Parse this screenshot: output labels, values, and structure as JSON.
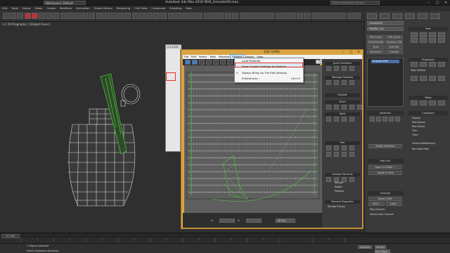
{
  "titlebar": {
    "workspace": "Workspace: Default",
    "title": "Autodesk 3ds Max 2016     MAX_Grenade00.max",
    "search_placeholder": "Type a keyword or phrase"
  },
  "main_menu": [
    "Edit",
    "Tools",
    "Group",
    "Views",
    "Create",
    "Modifiers",
    "Animation",
    "Graph Editors",
    "Rendering",
    "Civil View",
    "Customize",
    "Scripting",
    "Help"
  ],
  "viewport": {
    "label": "[+] [Orthographic ] [Edged Faces]"
  },
  "modifier_float": {
    "title": "v.4.1016"
  },
  "uvw_window": {
    "title": "Edit UVWs",
    "menu": [
      "File",
      "Edit",
      "Select",
      "Tools",
      "Mapping",
      "Options",
      "Display",
      "View"
    ],
    "active_menu": "Options",
    "map_dropdown": "CheckerPattern ( Checker )",
    "options_menu": [
      {
        "label": "Load Defaults",
        "shortcut": "",
        "checked": false
      },
      {
        "label": "Save Current Settings As Default",
        "shortcut": "",
        "checked": false
      },
      {
        "label": "Always Bring Up The Edit Window",
        "shortcut": "",
        "checked": true
      },
      {
        "label": "Preferences...",
        "shortcut": "Ctrl+O",
        "checked": false
      }
    ],
    "right_panel": {
      "quick_transform": "Quick Transform",
      "reshape": "Reshape Elements",
      "stitch": "Stitch",
      "explode": "Explode",
      "weld": "Weld",
      "peel": "Peel",
      "arrange": "Arrange Elements",
      "rescale": "Rescale",
      "rotate": "Rotate",
      "padding": "Padding:",
      "element_props": "Element Properties",
      "rescale_priority": "Rescale Priority"
    },
    "bottom": {
      "u_label": "U:",
      "v_label": "V:",
      "zoom_label": "UV",
      "xy_mode": "XY",
      "mode": "All IDs"
    }
  },
  "command_panel": {
    "object_name": "Grenade00",
    "modifier_list": "Modifier List",
    "buttons": [
      "FFD 2x2x2",
      "FFD 3x3x3",
      "TurboSmooth",
      "Unwrap UVW",
      "Shell",
      "Edit Poly",
      "Symmetry",
      "Chamfer"
    ],
    "stack_item": "Unwrap UVW",
    "selection_header": "Selection",
    "modify_selection": "Modify Selection",
    "edit_uvs": "Edit UVs",
    "open_uv_editor": "Open UV Editor ...",
    "tweak_in_view": "Tweak In View",
    "channel_header": "Channel",
    "reset_uvws": "Reset UVWs",
    "save": "Save...",
    "load": "Load...",
    "map_channel": "Map Channel:",
    "vertex_color": "Vertex Color Channel",
    "peel_header": "Peel",
    "projection_header": "Projection",
    "wrap_header": "Wrap",
    "configure_header": "Configure",
    "align_options": "Align Options",
    "display": "Display",
    "map_seams": "Map Seams",
    "peel_seams": "Peel Seams",
    "thin": "Thin",
    "thick": "Thick",
    "prevent_reflattening": "Prevent Reflattening",
    "normalize_map": "Normalize Map"
  },
  "timeline": {
    "frame": "0 / 100"
  },
  "status": {
    "selected": "1 Object Selected",
    "prompt": "Select keyboard operators",
    "selected_label": "Selected",
    "set_key": "Set Key",
    "key_filters": "Key Filters..."
  },
  "colors": {
    "uvw_frame": "#d9a441",
    "wire_white": "#d8d8d8",
    "wire_green": "#4ecb3b",
    "highlight_red": "#e53225"
  }
}
